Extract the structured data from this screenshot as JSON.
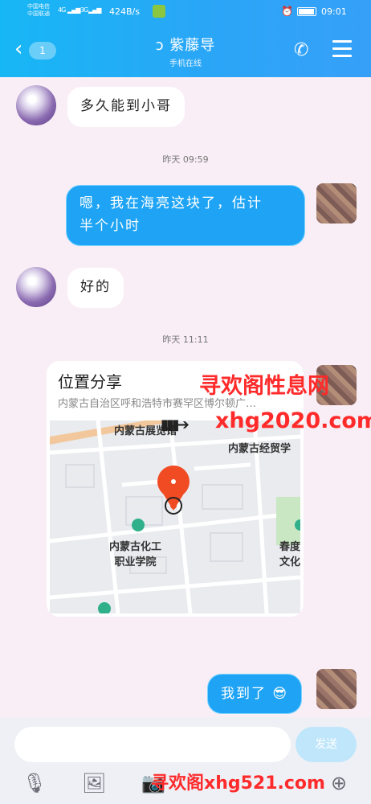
{
  "status_bar": {
    "carrier_1": "中国电信",
    "carrier_2": "中国联通",
    "net_1": "4G",
    "net_2": "3G",
    "speed": "424B/s",
    "time": "09:01"
  },
  "header": {
    "back_icon": "chevron-left-icon",
    "unread": "1",
    "title": "紫藤导",
    "subtitle": "手机在线",
    "call_icon": "phone-icon",
    "menu_icon": "menu-icon"
  },
  "messages": {
    "m1": "多久能到小哥",
    "ts1": "昨天 09:59",
    "m2_line1": "嗯，我在海亮这块了，估计",
    "m2_line2": "半个小时",
    "m3": "好的",
    "ts2": "昨天 11:11",
    "m5": "我到了"
  },
  "location_card": {
    "title": "位置分享",
    "address": "内蒙古自治区呼和浩特市赛罕区博尔顿广…",
    "poi_1": "内蒙古展览馆",
    "poi_2": "内蒙古经贸学",
    "poi_3_line1": "内蒙古化工",
    "poi_3_line2": "职业学院",
    "poi_4_line1": "春度",
    "poi_4_line2": "文化"
  },
  "watermarks": {
    "w1": "寻欢阁性息网",
    "w2": "xhg2020.com",
    "w3": "寻欢阁xhg521.com"
  },
  "input_bar": {
    "placeholder": "",
    "send_label": "发送"
  },
  "colors": {
    "header_start": "#17b7f5",
    "header_end": "#36a0f8",
    "outgoing_bubble": "#1fa4f5",
    "map_pin": "#f04b23",
    "watermark": "#ff2b2b"
  }
}
